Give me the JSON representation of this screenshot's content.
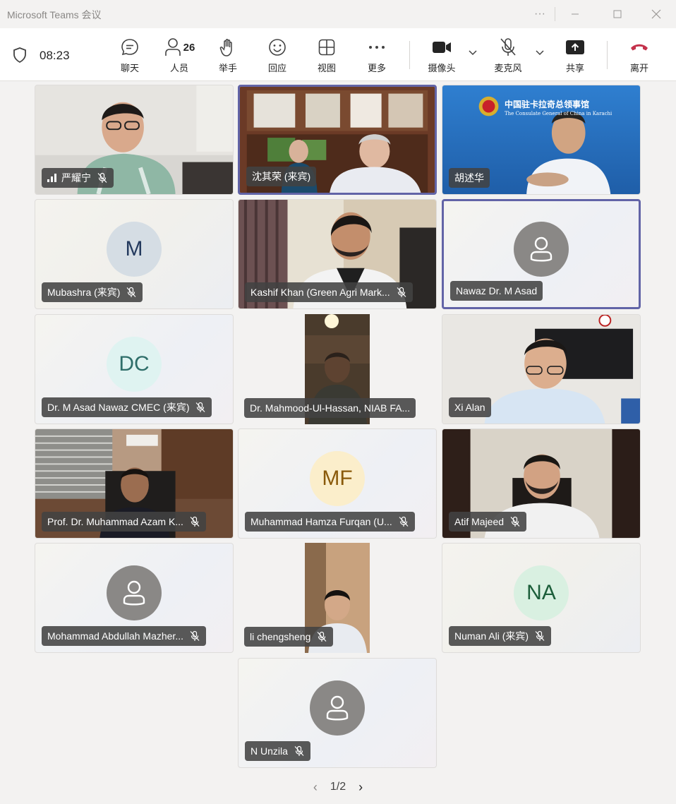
{
  "window": {
    "title": "Microsoft Teams 会议"
  },
  "toolbar": {
    "timer": "08:23",
    "chat": "聊天",
    "people": "人员",
    "people_count": "26",
    "raise_hand": "举手",
    "react": "回应",
    "view": "视图",
    "more": "更多",
    "camera": "摄像头",
    "mic": "麦克风",
    "share": "共享",
    "leave": "离开",
    "leave_color": "#c4314b"
  },
  "participants": [
    {
      "name": "严耀宁",
      "type": "video",
      "mic_muted": true,
      "signal": true
    },
    {
      "name": "沈其荣 (来宾)",
      "type": "video",
      "active_speaker": true
    },
    {
      "name": "胡述华",
      "type": "video"
    },
    {
      "name": "Mubashra (来宾)",
      "type": "avatar",
      "initials": "M",
      "avatar_bg": "#d5dde4",
      "avatar_fg": "#243a5e",
      "mic_muted": true
    },
    {
      "name": "Kashif Khan (Green Agri Mark...",
      "type": "video",
      "mic_muted": true
    },
    {
      "name": "Nawaz Dr. M Asad",
      "type": "avatar",
      "icon": "person-icon",
      "active_speaker": true
    },
    {
      "name": "Dr. M Asad Nawaz CMEC (来宾)",
      "type": "avatar",
      "initials": "DC",
      "avatar_bg": "#dff3f1",
      "avatar_fg": "#2f6e6a",
      "mic_muted": true
    },
    {
      "name": "Dr. Mahmood-Ul-Hassan, NIAB FA...",
      "type": "video"
    },
    {
      "name": "Xi Alan",
      "type": "video"
    },
    {
      "name": "Prof. Dr. Muhammad Azam K...",
      "type": "video",
      "mic_muted": true
    },
    {
      "name": "Muhammad Hamza Furqan (U...",
      "type": "avatar",
      "initials": "MF",
      "avatar_bg": "#fbeecb",
      "avatar_fg": "#8a5a0a",
      "mic_muted": true
    },
    {
      "name": "Atif Majeed",
      "type": "video",
      "mic_muted": true
    },
    {
      "name": "Mohammad Abdullah Mazher...",
      "type": "avatar",
      "icon": "person-icon",
      "mic_muted": true
    },
    {
      "name": "li chengsheng",
      "type": "video",
      "mic_muted": true
    },
    {
      "name": "Numan Ali (来宾)",
      "type": "avatar",
      "initials": "NA",
      "avatar_bg": "#d9f0e1",
      "avatar_fg": "#1c5e3a",
      "mic_muted": true
    },
    {
      "name": "N Unzila",
      "type": "avatar",
      "icon": "person-icon",
      "mic_muted": true
    }
  ],
  "consulate_banner": {
    "cn": "中国驻卡拉奇总领事馆",
    "en": "The Consulate General of China in Karachi"
  },
  "pager": {
    "label": "1/2"
  },
  "accent_color": "#6264a7"
}
